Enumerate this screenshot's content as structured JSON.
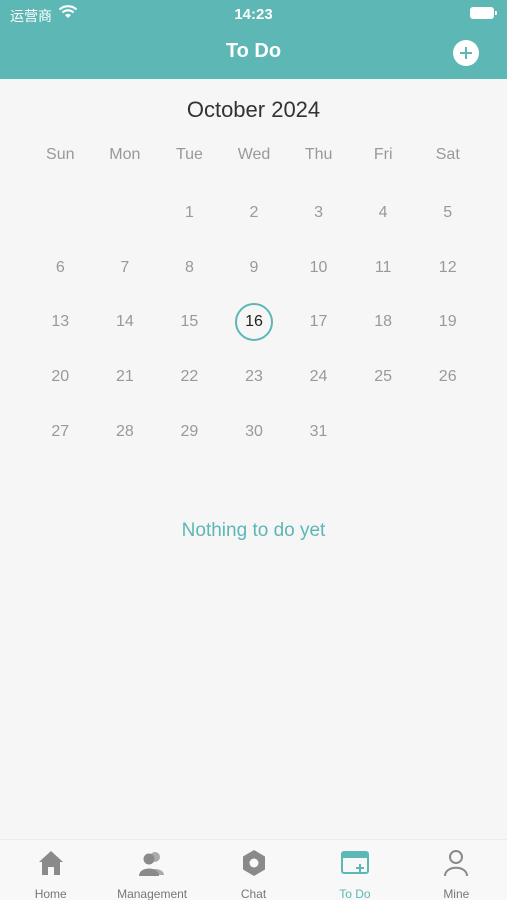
{
  "status_bar": {
    "carrier": "运营商",
    "time": "14:23"
  },
  "nav": {
    "title": "To Do"
  },
  "calendar": {
    "month_title": "October 2024",
    "weekdays": [
      "Sun",
      "Mon",
      "Tue",
      "Wed",
      "Thu",
      "Fri",
      "Sat"
    ],
    "days": [
      "",
      "",
      "1",
      "2",
      "3",
      "4",
      "5",
      "6",
      "7",
      "8",
      "9",
      "10",
      "11",
      "12",
      "13",
      "14",
      "15",
      "16",
      "17",
      "18",
      "19",
      "20",
      "21",
      "22",
      "23",
      "24",
      "25",
      "26",
      "27",
      "28",
      "29",
      "30",
      "31"
    ],
    "selected_day": "16"
  },
  "empty_message": "Nothing to do yet",
  "tabs": [
    {
      "label": "Home",
      "icon": "home-icon"
    },
    {
      "label": "Management",
      "icon": "people-icon"
    },
    {
      "label": "Chat",
      "icon": "hexagon-icon"
    },
    {
      "label": "To Do",
      "icon": "calendar-add-icon",
      "active": true
    },
    {
      "label": "Mine",
      "icon": "person-icon"
    }
  ],
  "colors": {
    "accent": "#5db7b5",
    "inactive": "#777777",
    "icon_gray": "#8a8a8a"
  }
}
